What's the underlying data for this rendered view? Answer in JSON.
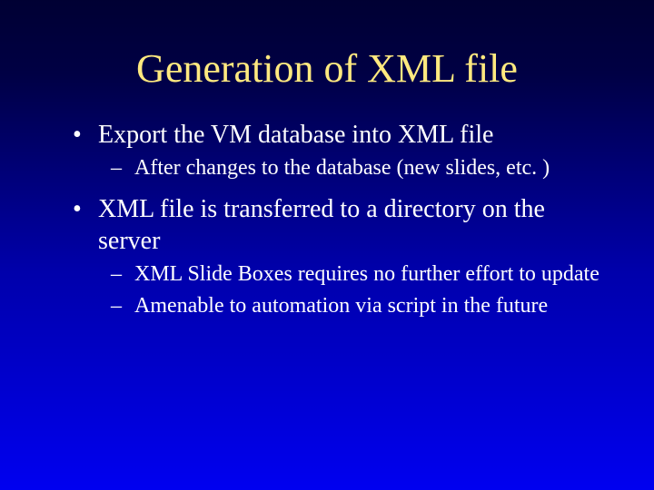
{
  "title": "Generation of XML file",
  "bullets": [
    {
      "text": "Export the VM database into XML file",
      "sub": [
        "After changes to the database (new slides, etc. )"
      ]
    },
    {
      "text": "XML file is transferred to a directory on the server",
      "sub": [
        "XML Slide Boxes requires no further effort to update",
        "Amenable to automation via script in the future"
      ]
    }
  ]
}
